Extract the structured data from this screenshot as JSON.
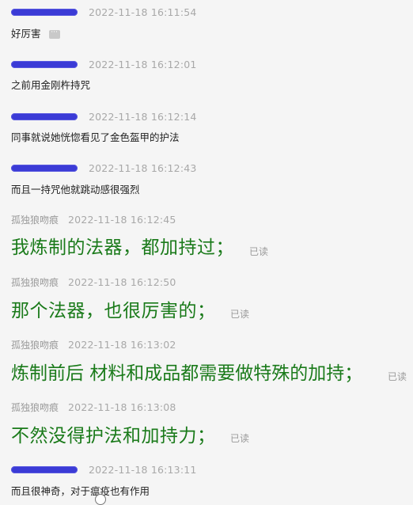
{
  "messages": [
    {
      "sender": "",
      "time": "2022-11-18 16:11:54",
      "text": "好厉害",
      "badge": "···"
    },
    {
      "sender": "",
      "time": "2022-11-18 16:12:01",
      "text": "之前用金刚杵持咒"
    },
    {
      "sender": "",
      "time": "2022-11-18 16:12:14",
      "text": "同事就说她恍惚看见了金色盔甲的护法"
    },
    {
      "sender": "",
      "time": "2022-11-18 16:12:43",
      "text": "而且一持咒他就跳动感很强烈"
    },
    {
      "sender": "孤独狼吻痕",
      "time": "2022-11-18 16:12:45",
      "text": "我炼制的法器，都加持过；",
      "status": "已读"
    },
    {
      "sender": "孤独狼吻痕",
      "time": "2022-11-18 16:12:50",
      "text": "那个法器，也很厉害的；",
      "status": "已读"
    },
    {
      "sender": "孤独狼吻痕",
      "time": "2022-11-18 16:13:02",
      "text": "炼制前后 材料和成品都需要做特殊的加持；",
      "status": "已读"
    },
    {
      "sender": "孤独狼吻痕",
      "time": "2022-11-18 16:13:08",
      "text": "不然没得护法和加持力；",
      "status": "已读"
    },
    {
      "sender": "",
      "time": "2022-11-18 16:13:11",
      "text": "而且很神奇，对于瘟疫也有作用"
    }
  ],
  "colors": {
    "reply_text": "#1a7a1a",
    "redaction": "#3b3bd6",
    "background": "#f5f5f5"
  }
}
